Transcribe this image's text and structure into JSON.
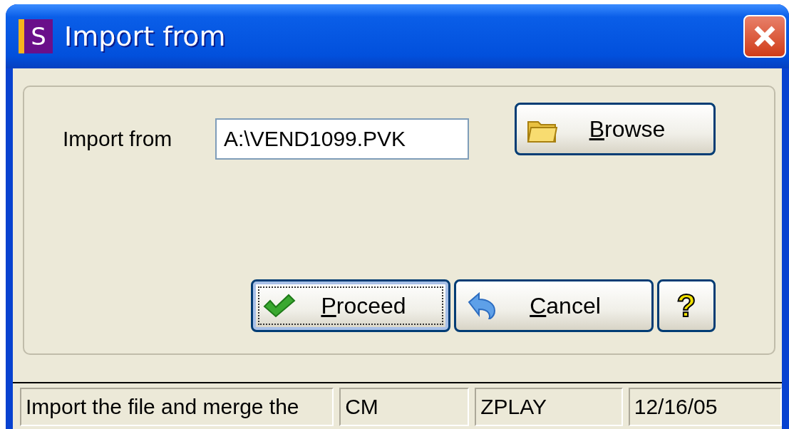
{
  "window": {
    "title": "Import from",
    "app_icon_letter": "S"
  },
  "form": {
    "label": "Import from",
    "value": "A:\\VEND1099.PVK"
  },
  "browse_button": {
    "label": "Browse",
    "mnemonic_underlined": true
  },
  "buttons": [
    {
      "kind": "proceed",
      "label": "Proceed",
      "mnemonic_underlined": true,
      "default": true
    },
    {
      "kind": "cancel",
      "label": "Cancel",
      "mnemonic_underlined": true,
      "default": false
    },
    {
      "kind": "help",
      "label": "?",
      "mnemonic_underlined": false,
      "default": false
    }
  ],
  "status_bar": [
    "Import the file and merge the",
    "CM",
    "ZPLAY",
    "12/16/05"
  ]
}
